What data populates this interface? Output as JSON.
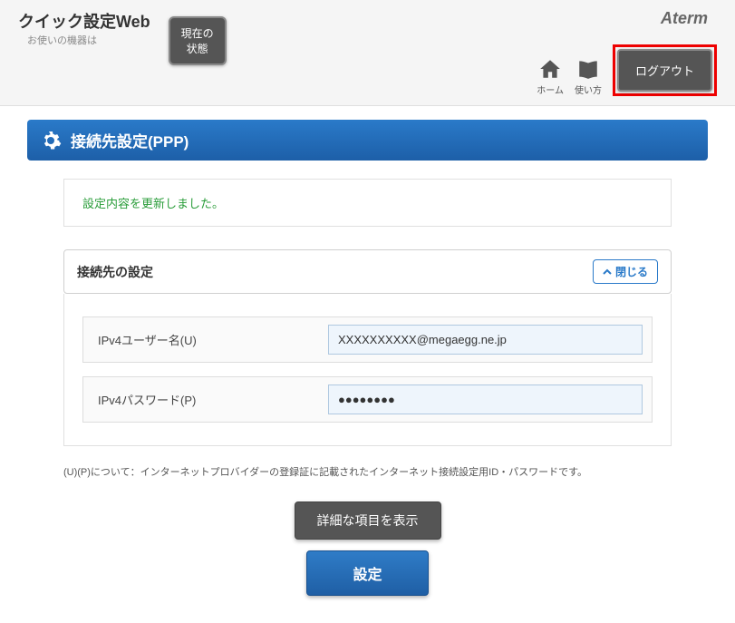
{
  "header": {
    "app_title": "クイック設定Web",
    "subtitle": "お使いの機器は",
    "status_button": "現在の\n状態",
    "brand": "Aterm",
    "home_label": "ホーム",
    "guide_label": "使い方",
    "logout_label": "ログアウト"
  },
  "page": {
    "title": "接続先設定(PPP)"
  },
  "message": {
    "text": "設定内容を更新しました。"
  },
  "panel": {
    "title": "接続先の設定",
    "close_label": "閉じる"
  },
  "form": {
    "username_label": "IPv4ユーザー名(U)",
    "username_value": "XXXXXXXXXX@megaegg.ne.jp",
    "password_label": "IPv4パスワード(P)",
    "password_value": "●●●●●●●●"
  },
  "note": "(U)(P)について：インターネットプロバイダーの登録証に記載されたインターネット接続設定用ID・パスワードです。",
  "buttons": {
    "detail": "詳細な項目を表示",
    "submit": "設定"
  }
}
